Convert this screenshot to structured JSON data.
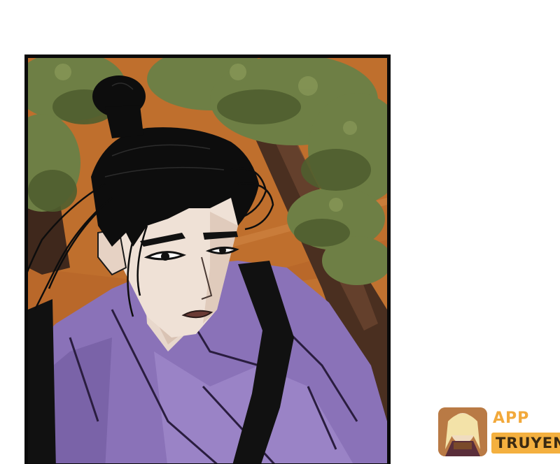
{
  "panel": {
    "subject": "character-portrait"
  },
  "watermark": {
    "line1": "APP",
    "line2": "TRUYEN",
    "accent_color": "#f2a93b"
  }
}
